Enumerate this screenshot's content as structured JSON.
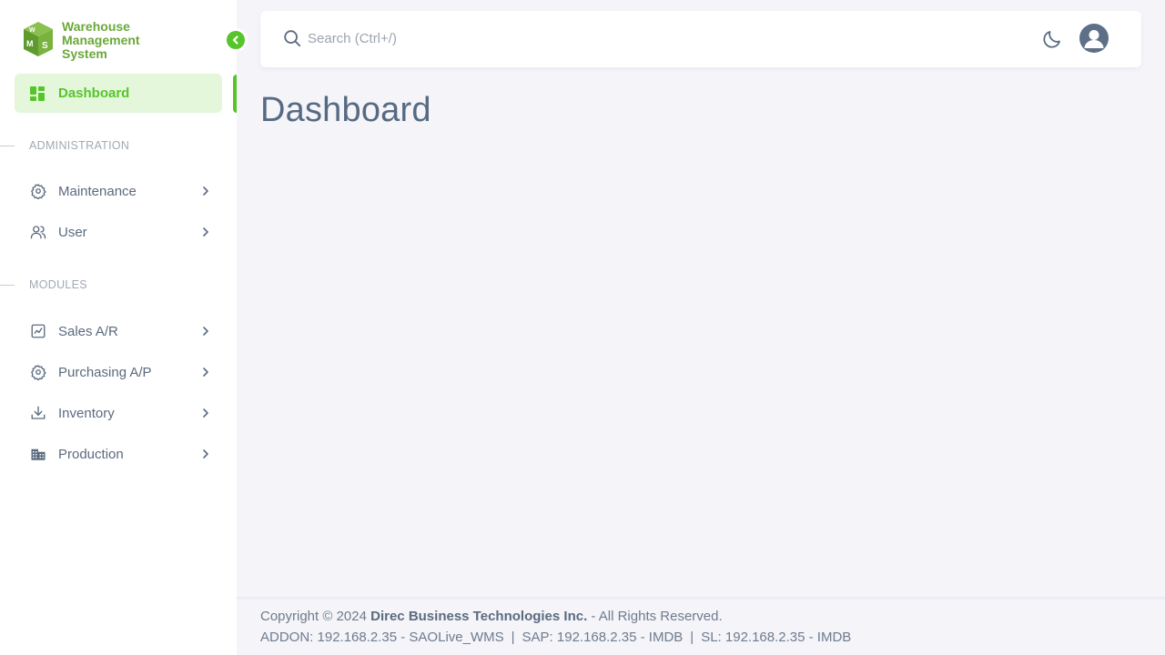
{
  "app": {
    "brand_lines": [
      "Warehouse",
      "Management",
      "System"
    ],
    "logo_letters": "WMS"
  },
  "colors": {
    "accent": "#56c52a",
    "brand_text": "#6aa83a",
    "text": "#5b6b7f",
    "background": "#f4f4f9"
  },
  "sidebar": {
    "active_item": {
      "label": "Dashboard",
      "icon": "dashboard-grid-icon"
    },
    "sections": [
      {
        "title": "ADMINISTRATION",
        "items": [
          {
            "label": "Maintenance",
            "icon": "gear-icon"
          },
          {
            "label": "User",
            "icon": "users-icon"
          }
        ]
      },
      {
        "title": "MODULES",
        "items": [
          {
            "label": "Sales A/R",
            "icon": "chart-line-icon"
          },
          {
            "label": "Purchasing A/P",
            "icon": "gear-icon"
          },
          {
            "label": "Inventory",
            "icon": "download-tray-icon"
          },
          {
            "label": "Production",
            "icon": "building-icon"
          }
        ]
      }
    ]
  },
  "header": {
    "search_placeholder": "Search (Ctrl+/)"
  },
  "main": {
    "title": "Dashboard"
  },
  "footer": {
    "copyright_prefix": "Copyright © 2024",
    "company": "Direc Business Technologies Inc.",
    "rights": "- All Rights Reserved.",
    "addon": "ADDON: 192.168.2.35 - SAOLive_WMS",
    "separator": "|",
    "sap": "SAP: 192.168.2.35 - IMDB",
    "sl": "SL: 192.168.2.35 - IMDB"
  }
}
